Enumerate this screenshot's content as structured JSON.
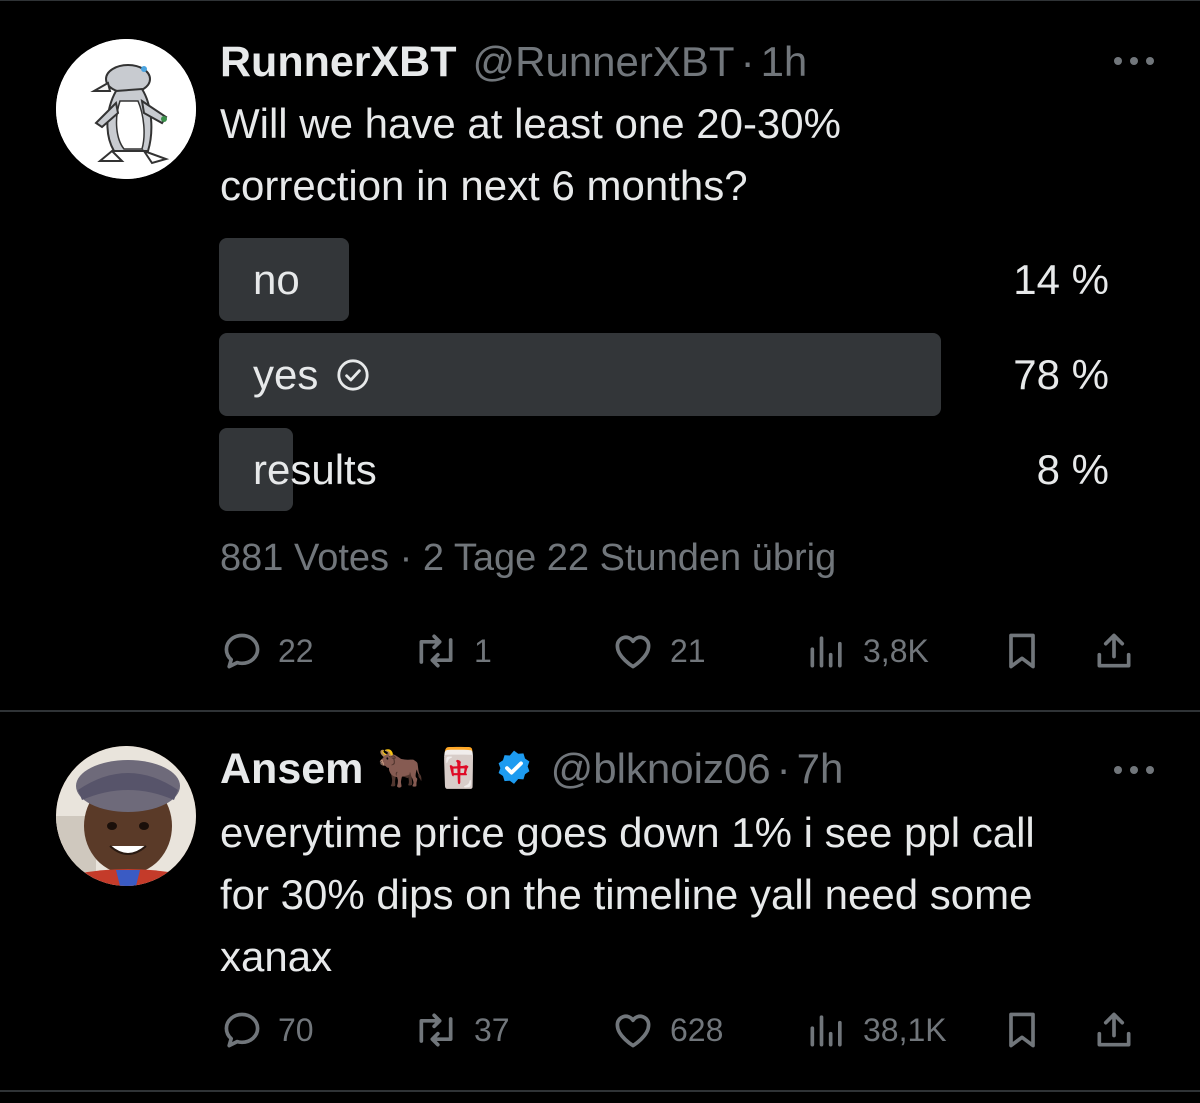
{
  "tweets": [
    {
      "name": "RunnerXBT",
      "handle": "@RunnerXBT",
      "separator": "·",
      "time": "1h",
      "text_lines": [
        "Will we have at least one 20-30%",
        "correction in next 6 months?"
      ],
      "poll": {
        "options": [
          {
            "label": "no",
            "percent": "14 %",
            "value": 14,
            "selected": false
          },
          {
            "label": "yes",
            "percent": "78 %",
            "value": 78,
            "selected": true
          },
          {
            "label": "results",
            "percent": "8 %",
            "value": 8,
            "selected": false
          }
        ],
        "votes": "881 Votes",
        "time_left": "2 Tage 22 Stunden übrig"
      },
      "actions": {
        "replies": "22",
        "reposts": "1",
        "likes": "21",
        "views": "3,8K"
      }
    },
    {
      "name": "Ansem",
      "emoji": "🐂 🀄",
      "handle": "@blknoiz06",
      "separator": "·",
      "time": "7h",
      "verified": true,
      "text_lines": [
        "everytime price goes down 1% i see ppl call",
        "for 30% dips on the timeline yall need some",
        "xanax"
      ],
      "actions": {
        "replies": "70",
        "reposts": "37",
        "likes": "628",
        "views": "38,1K"
      }
    }
  ],
  "colors": {
    "background": "#000000",
    "text": "#e7e9ea",
    "muted": "#71767b",
    "poll_fill": "#333639",
    "verified": "#1d9bf0",
    "divider": "#2f3336"
  },
  "icons": [
    "reply-icon",
    "repost-icon",
    "like-icon",
    "views-icon",
    "bookmark-icon",
    "share-icon",
    "check-circle-icon",
    "verified-badge-icon",
    "more-icon"
  ]
}
